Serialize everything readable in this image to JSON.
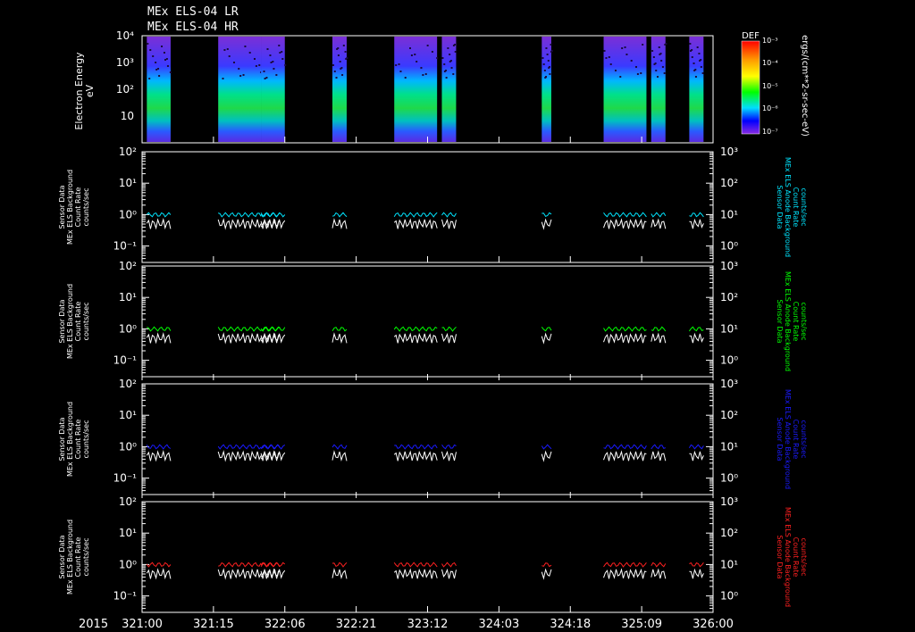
{
  "titles": [
    "MEx ELS-04 LR",
    "MEx ELS-04 HR"
  ],
  "colorbar": {
    "label": "DEF",
    "unit": "ergs/(cm**2-sr-sec-eV)",
    "ticks": [
      "10⁻³",
      "10⁻⁴",
      "10⁻⁵",
      "10⁻⁶",
      "10⁻⁷"
    ],
    "colors": [
      "#ff0000",
      "#ff8c00",
      "#ffff00",
      "#00ff00",
      "#00ffff",
      "#0000ff",
      "#8a2be2"
    ]
  },
  "x_axis": {
    "year": "2015",
    "ticks": [
      "321:00",
      "321:15",
      "322:06",
      "322:21",
      "323:12",
      "324:03",
      "324:18",
      "325:09",
      "326:00"
    ]
  },
  "spectrogram": {
    "ylabel": [
      "Electron Energy",
      "eV"
    ],
    "yticks": [
      "10⁴",
      "10³",
      "10²",
      "10",
      ""
    ]
  },
  "panels": [
    {
      "left_label": [
        "Sensor Data",
        "MEx ELS Background",
        "Count Rate",
        "counts/sec"
      ],
      "right_label": [
        "Sensor Data",
        "MEx ELS Anode Background",
        "Count Rate",
        "counts/sec"
      ],
      "color": "#00e5ff",
      "left_ticks": [
        "10²",
        "10¹",
        "10⁰",
        "10⁻¹"
      ],
      "right_ticks": [
        "10³",
        "10²",
        "10¹",
        "10⁰"
      ]
    },
    {
      "left_label": [
        "Sensor Data",
        "MEx ELS Background",
        "Count Rate",
        "counts/sec"
      ],
      "right_label": [
        "Sensor Data",
        "MEx ELS Anode Background",
        "Count Rate",
        "counts/sec"
      ],
      "color": "#00ff00",
      "left_ticks": [
        "10²",
        "10¹",
        "10⁰",
        "10⁻¹"
      ],
      "right_ticks": [
        "10³",
        "10²",
        "10¹",
        "10⁰"
      ]
    },
    {
      "left_label": [
        "Sensor Data",
        "MEx ELS Background",
        "Count Rate",
        "counts/sec"
      ],
      "right_label": [
        "Sensor Data",
        "MEx ELS Anode Background",
        "Count Rate",
        "counts/sec"
      ],
      "color": "#1a1aff",
      "left_ticks": [
        "10²",
        "10¹",
        "10⁰",
        "10⁻¹"
      ],
      "right_ticks": [
        "10³",
        "10²",
        "10¹",
        "10⁰"
      ]
    },
    {
      "left_label": [
        "Sensor Data",
        "MEx ELS Background",
        "Count Rate",
        "counts/sec"
      ],
      "right_label": [
        "Sensor Data",
        "MEx ELS Anode Background",
        "Count Rate",
        "counts/sec"
      ],
      "color": "#ff2020",
      "left_ticks": [
        "10²",
        "10¹",
        "10⁰",
        "10⁻¹"
      ],
      "right_ticks": [
        "10³",
        "10²",
        "10¹",
        "10⁰"
      ]
    }
  ],
  "chart_data": {
    "type": "line",
    "x_range": [
      "321:00",
      "326:00"
    ],
    "y_left_range_counts_per_sec": [
      0.03,
      100
    ],
    "y_right_range_counts_per_sec": [
      0.3,
      1000
    ],
    "spectrogram_y_range_eV": [
      3,
      10000
    ],
    "observation_windows": [
      [
        "321:01",
        "321:06"
      ],
      [
        "321:16",
        "321:25"
      ],
      [
        "321:25",
        "321:29"
      ],
      [
        "322:01",
        "322:06"
      ],
      [
        "322:16",
        "322:19"
      ],
      [
        "323:05",
        "323:14"
      ],
      [
        "323:15",
        "323:18"
      ],
      [
        "324:12",
        "324:14"
      ],
      [
        "325:01",
        "325:10"
      ],
      [
        "325:11",
        "325:14"
      ],
      [
        "325:19",
        "325:22"
      ]
    ],
    "level_background": 1.0,
    "level_anode": 0.7
  }
}
